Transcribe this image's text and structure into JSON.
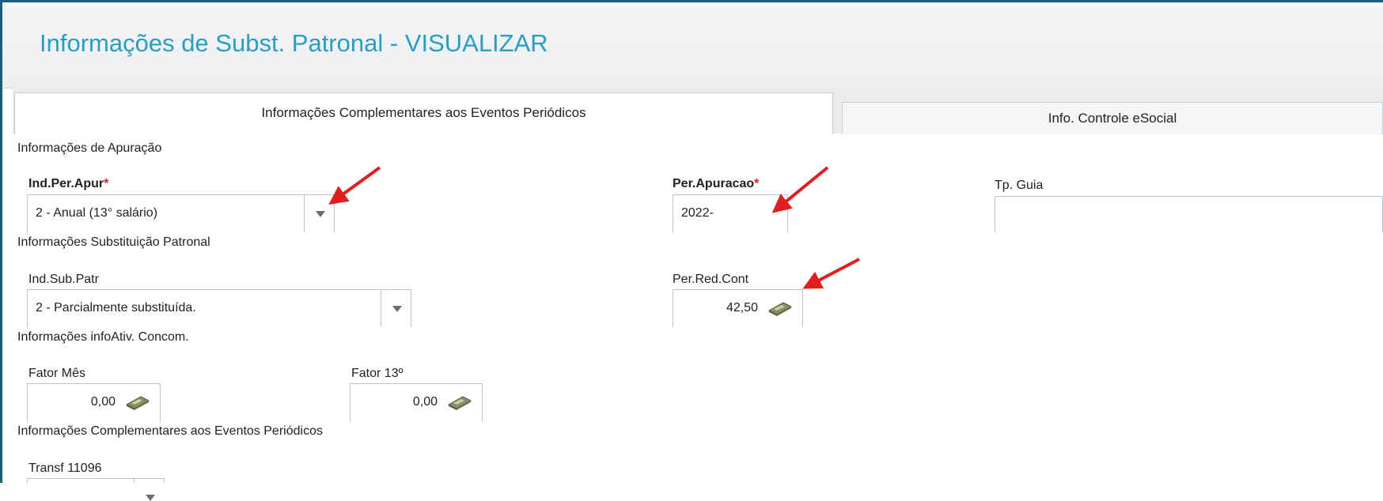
{
  "page": {
    "title": "Informações de Subst. Patronal - VISUALIZAR"
  },
  "tabs": [
    {
      "label": "Informações Complementares aos Eventos Periódicos",
      "active": true
    },
    {
      "label": "Info. Controle eSocial",
      "active": false
    }
  ],
  "sections": {
    "apuracao": "Informações de Apuração",
    "substituicao": "Informações Substituição Patronal",
    "infoativ": "Informações infoAtiv. Concom.",
    "complementares": "Informações Complementares aos Eventos Periódicos"
  },
  "fields": {
    "ind_per_apur": {
      "label": "Ind.Per.Apur",
      "required_mark": "*",
      "value": "2 - Anual (13° salário)"
    },
    "per_apuracao": {
      "label": "Per.Apuracao",
      "required_mark": "*",
      "value": "2022-"
    },
    "tp_guia": {
      "label": "Tp. Guia",
      "value": ""
    },
    "ind_sub_patr": {
      "label": "Ind.Sub.Patr",
      "value": "2 - Parcialmente substituída."
    },
    "per_red_cont": {
      "label": "Per.Red.Cont",
      "value": "42,50"
    },
    "fator_mes": {
      "label": "Fator Mês",
      "value": "0,00"
    },
    "fator_13": {
      "label": "Fator 13º",
      "value": "0,00"
    },
    "transf_11096": {
      "label": "Transf 11096"
    }
  },
  "icons": {
    "select_arrow": "chevron-down-icon",
    "calculator": "calculator-icon",
    "annotation": "red-arrow-annotation"
  },
  "colors": {
    "title": "#2a9ec2",
    "required": "#e02020",
    "annotation_arrow": "#e02020",
    "frame": "#1f5c76"
  }
}
